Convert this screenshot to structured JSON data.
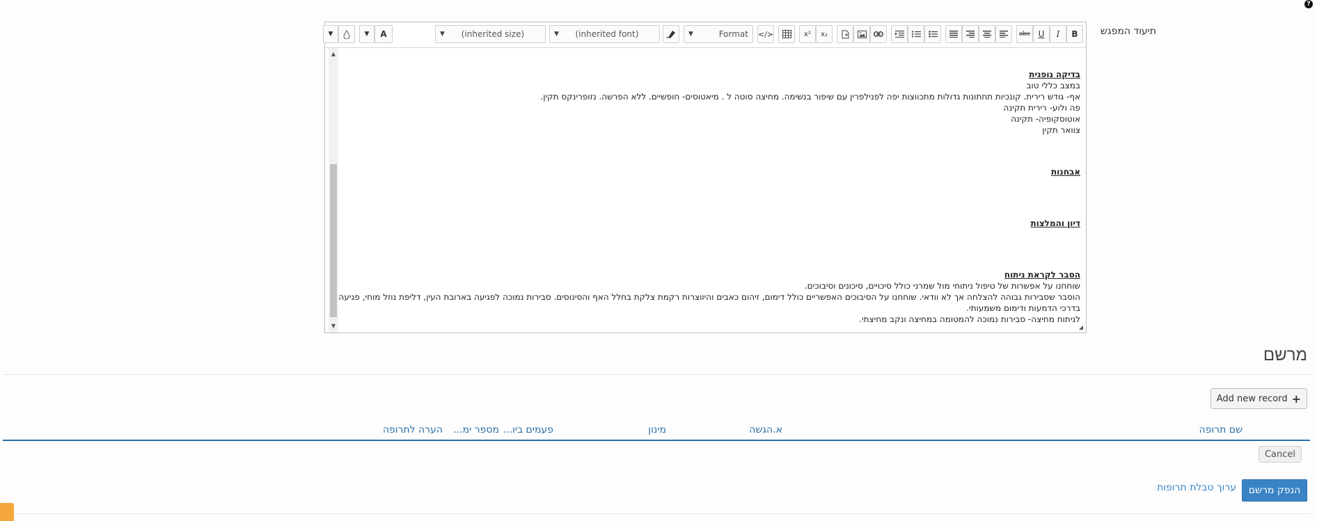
{
  "help_icon": "?",
  "field_label": "תיעוד המפגש",
  "toolbar": {
    "bold": "B",
    "italic": "I",
    "underline": "U",
    "strike": "abc",
    "format_label": "Format",
    "font_label": "(inherited font)",
    "size_label": "(inherited size)",
    "text_color": "A",
    "superscript": "x²",
    "subscript": "x₂"
  },
  "editor": {
    "lines": [
      {
        "text": "בדיקה גופנית",
        "heading": true,
        "gap_before": 0
      },
      {
        "text": "במצב כללי טוב",
        "heading": false,
        "gap_before": 0
      },
      {
        "text": "אף- גודש רירית. קונכיות תחתונות גדולות מתכווצות יפה לפנילפרין עם שיפור בנשימה. מחיצה סוטה ל . מיאטוסים- חופשיים. ללא הפרשה. נזופרינקס תקין.",
        "heading": false,
        "gap_before": 0
      },
      {
        "text": "פה ולוע- רירית תקינה",
        "heading": false,
        "gap_before": 0
      },
      {
        "text": "אוטוסקופיה- תקינה",
        "heading": false,
        "gap_before": 0
      },
      {
        "text": "צוואר תקין",
        "heading": false,
        "gap_before": 0
      },
      {
        "text": "אבחנות",
        "heading": true,
        "gap_before": 44
      },
      {
        "text": "דיון והמלצות",
        "heading": true,
        "gap_before": 58
      },
      {
        "text": "הסבר לקראת ניתוח",
        "heading": true,
        "gap_before": 58
      },
      {
        "text": "שוחחנו על אפשרות של טיפול ניתוחי מול שמרני כולל סיכויים, סיכונים וסיבוכים.",
        "heading": false,
        "gap_before": 0
      },
      {
        "text": "הוסבר שסבירות גבוהה להצלחה אך לא וודאי. שוחחנו על הסיבוכים האפשריים כולל דימום, זיהום כאבים והיווצרות רקמת צלקת בחלל האף והסינוסים. סבירות נמוכה לפגיעה בארובת העין, דליפת נוזל מוחי, פגיעה",
        "heading": false,
        "gap_before": 0
      },
      {
        "text": "בדרכי הדמעות ודימום משמעותי.",
        "heading": false,
        "gap_before": 0
      },
      {
        "text": "לניתוח מחיצה- סבירות נמוכה להמטומה במחיצה ונקב מחיצתי.",
        "heading": false,
        "gap_before": 0
      }
    ]
  },
  "prescription": {
    "title": "מרשם",
    "add_record": "Add new record",
    "columns": [
      "שם תרופה",
      "א.הגשה",
      "מינון",
      "פעמים ביו...",
      "מספר ימ...",
      "הערה לתרופה"
    ],
    "cancel": "Cancel",
    "issue": "הנפק מרשם",
    "edit_table": "ערוך טבלת תרופות"
  },
  "colors": {
    "accent": "#3a84c6",
    "header_text": "#2a6fa8",
    "tab_orange": "#f4a83c"
  }
}
